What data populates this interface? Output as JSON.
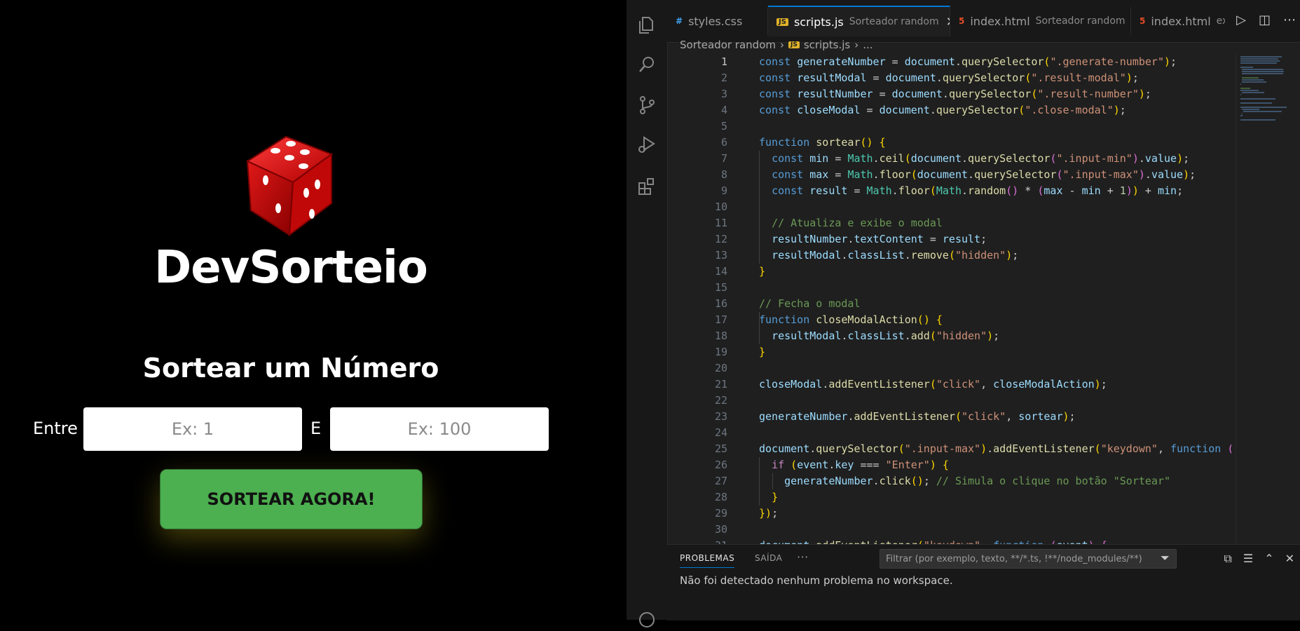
{
  "app": {
    "brand": "DevSorteio",
    "subtitle": "Sortear um Número",
    "label_from": "Entre",
    "label_and": "E",
    "min_placeholder": "Ex: 1",
    "max_placeholder": "Ex: 100",
    "draw_button": "SORTEAR AGORA!",
    "colors": {
      "button": "#4caf50",
      "dice": "#d81010"
    }
  },
  "vscode": {
    "tabs": [
      {
        "file": "styles.css",
        "desc": "",
        "icon": "css-file-icon"
      },
      {
        "file": "scripts.js",
        "desc": "Sorteador random",
        "icon": "js-file-icon",
        "active": true
      },
      {
        "file": "index.html",
        "desc": "Sorteador random",
        "icon": "html-file-icon"
      },
      {
        "file": "index.html",
        "desc": "execi",
        "icon": "html-file-icon"
      }
    ],
    "breadcrumb": {
      "folder": "Sorteador random",
      "file": "scripts.js",
      "rest": "..."
    },
    "activity_icons": [
      "explorer-icon",
      "search-icon",
      "source-control-icon",
      "run-debug-icon",
      "extensions-icon"
    ],
    "panel": {
      "tab_problems": "PROBLEMAS",
      "tab_output": "SAÍDA",
      "more": "···",
      "filter_placeholder": "Filtrar (por exemplo, texto, **/*.ts, !**/node_modules/**)",
      "message": "Não foi detectado nenhum problema no workspace."
    },
    "code_lines": [
      "const generateNumber = document.querySelector(\".generate-number\");",
      "const resultModal = document.querySelector(\".result-modal\");",
      "const resultNumber = document.querySelector(\".result-number\");",
      "const closeModal = document.querySelector(\".close-modal\");",
      "",
      "function sortear() {",
      "  const min = Math.ceil(document.querySelector(\".input-min\").value);",
      "  const max = Math.floor(document.querySelector(\".input-max\").value);",
      "  const result = Math.floor(Math.random() * (max - min + 1)) + min;",
      "",
      "  // Atualiza e exibe o modal",
      "  resultNumber.textContent = result;",
      "  resultModal.classList.remove(\"hidden\");",
      "}",
      "",
      "// Fecha o modal",
      "function closeModalAction() {",
      "  resultModal.classList.add(\"hidden\");",
      "}",
      "",
      "closeModal.addEventListener(\"click\", closeModalAction);",
      "",
      "generateNumber.addEventListener(\"click\", sortear);",
      "",
      "document.querySelector(\".input-max\").addEventListener(\"keydown\", function (even",
      "  if (event.key === \"Enter\") {",
      "    generateNumber.click(); // Simula o clique no botão \"Sortear\"",
      "  }",
      "});",
      "",
      "document.addEventListener(\"keydown\", function (event) {"
    ]
  }
}
